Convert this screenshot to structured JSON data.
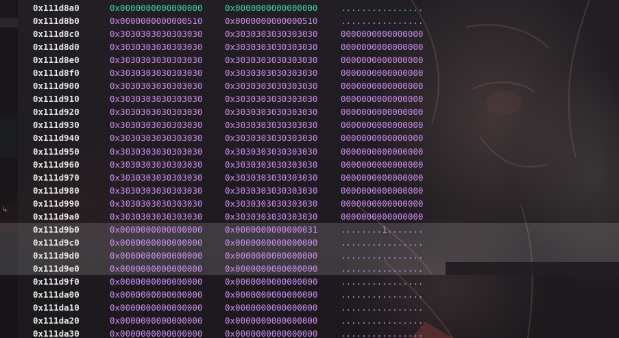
{
  "memory_dump": {
    "rows": [
      {
        "addr": "0x111d8a0",
        "q1": "0x0000000000000000",
        "q2": "0x0000000000000000",
        "ascii": "................"
      },
      {
        "addr": "0x111d8b0",
        "q1": "0x0000000000000510",
        "q2": "0x0000000000000510",
        "ascii": "................"
      },
      {
        "addr": "0x111d8c0",
        "q1": "0x3030303030303030",
        "q2": "0x3030303030303030",
        "ascii": "0000000000000000"
      },
      {
        "addr": "0x111d8d0",
        "q1": "0x3030303030303030",
        "q2": "0x3030303030303030",
        "ascii": "0000000000000000"
      },
      {
        "addr": "0x111d8e0",
        "q1": "0x3030303030303030",
        "q2": "0x3030303030303030",
        "ascii": "0000000000000000"
      },
      {
        "addr": "0x111d8f0",
        "q1": "0x3030303030303030",
        "q2": "0x3030303030303030",
        "ascii": "0000000000000000"
      },
      {
        "addr": "0x111d900",
        "q1": "0x3030303030303030",
        "q2": "0x3030303030303030",
        "ascii": "0000000000000000"
      },
      {
        "addr": "0x111d910",
        "q1": "0x3030303030303030",
        "q2": "0x3030303030303030",
        "ascii": "0000000000000000"
      },
      {
        "addr": "0x111d920",
        "q1": "0x3030303030303030",
        "q2": "0x3030303030303030",
        "ascii": "0000000000000000"
      },
      {
        "addr": "0x111d930",
        "q1": "0x3030303030303030",
        "q2": "0x3030303030303030",
        "ascii": "0000000000000000"
      },
      {
        "addr": "0x111d940",
        "q1": "0x3030303030303030",
        "q2": "0x3030303030303030",
        "ascii": "0000000000000000"
      },
      {
        "addr": "0x111d950",
        "q1": "0x3030303030303030",
        "q2": "0x3030303030303030",
        "ascii": "0000000000000000"
      },
      {
        "addr": "0x111d960",
        "q1": "0x3030303030303030",
        "q2": "0x3030303030303030",
        "ascii": "0000000000000000"
      },
      {
        "addr": "0x111d970",
        "q1": "0x3030303030303030",
        "q2": "0x3030303030303030",
        "ascii": "0000000000000000"
      },
      {
        "addr": "0x111d980",
        "q1": "0x3030303030303030",
        "q2": "0x3030303030303030",
        "ascii": "0000000000000000"
      },
      {
        "addr": "0x111d990",
        "q1": "0x3030303030303030",
        "q2": "0x3030303030303030",
        "ascii": "0000000000000000"
      },
      {
        "addr": "0x111d9a0",
        "q1": "0x3030303030303030",
        "q2": "0x3030303030303030",
        "ascii": "0000000000000000"
      },
      {
        "addr": "0x111d9b0",
        "q1": "0x0000000000000000",
        "q2": "0x0000000000000031",
        "ascii": "........1......."
      },
      {
        "addr": "0x111d9c0",
        "q1": "0x0000000000000000",
        "q2": "0x0000000000000000",
        "ascii": "................"
      },
      {
        "addr": "0x111d9d0",
        "q1": "0x0000000000000000",
        "q2": "0x0000000000000000",
        "ascii": "................"
      },
      {
        "addr": "0x111d9e0",
        "q1": "0x0000000000000000",
        "q2": "0x0000000000000000",
        "ascii": "................"
      },
      {
        "addr": "0x111d9f0",
        "q1": "0x0000000000000000",
        "q2": "0x0000000000000000",
        "ascii": "................"
      },
      {
        "addr": "0x111da00",
        "q1": "0x0000000000000000",
        "q2": "0x0000000000000000",
        "ascii": "................"
      },
      {
        "addr": "0x111da10",
        "q1": "0x0000000000000000",
        "q2": "0x0000000000000000",
        "ascii": "................"
      },
      {
        "addr": "0x111da20",
        "q1": "0x0000000000000000",
        "q2": "0x0000000000000000",
        "ascii": "................"
      },
      {
        "addr": "0x111da30",
        "q1": "0x0000000000000000",
        "q2": "0x0000000000000000",
        "ascii": "................"
      }
    ]
  },
  "gutter": {
    "wrap_glyph": "↳"
  },
  "colors": {
    "address": "#e4e4e4",
    "value": "#d08ef0",
    "first_row_value": "#3fd6b0",
    "selection": "rgba(255,255,255,0.14)"
  }
}
